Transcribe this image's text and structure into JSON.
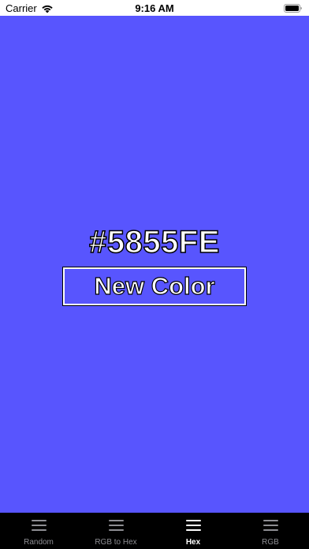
{
  "status_bar": {
    "carrier": "Carrier",
    "time": "9:16 AM"
  },
  "main": {
    "background_color": "#5855FE",
    "hex_label": "#5855FE",
    "new_color_button_label": "New Color"
  },
  "tab_bar": {
    "tabs": [
      {
        "label": "Random",
        "icon": "hamburger-icon",
        "active": false
      },
      {
        "label": "RGB to Hex",
        "icon": "hamburger-icon",
        "active": false
      },
      {
        "label": "Hex",
        "icon": "hamburger-icon",
        "active": true
      },
      {
        "label": "RGB",
        "icon": "hamburger-icon",
        "active": false
      }
    ],
    "active_color": "#ffffff",
    "inactive_color": "#8e8e93"
  }
}
